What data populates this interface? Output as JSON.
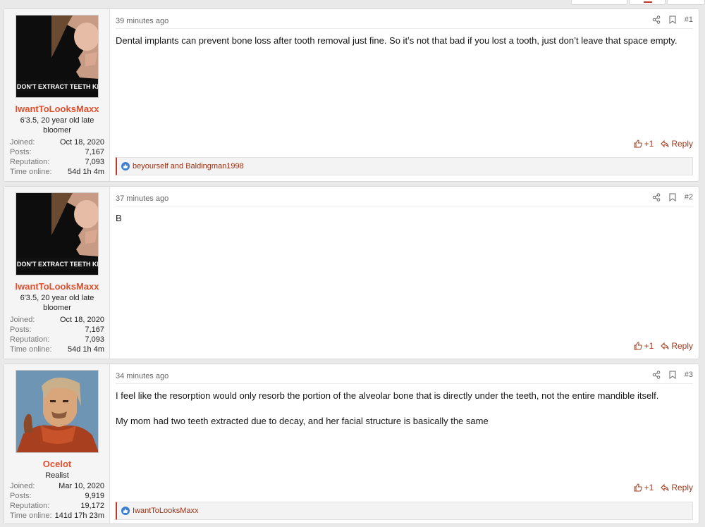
{
  "posts": [
    {
      "user": {
        "name": "IwantToLooksMaxx",
        "title": "6'3.5, 20 year old late bloomer",
        "avatar_caption": "DON'T EXTRACT TEETH KI",
        "joined": "Oct 18, 2020",
        "posts": "7,167",
        "reputation": "7,093",
        "time_online": "54d 1h 4m"
      },
      "time": "39 minutes ago",
      "number": "#1",
      "body": [
        "Dental implants can prevent bone loss after tooth removal just fine. So it’s not that bad if you lost a tooth, just don’t leave that space empty."
      ],
      "like_count": "+1",
      "reply_label": "Reply",
      "reactions": "beyourself and Baldingman1998"
    },
    {
      "user": {
        "name": "IwantToLooksMaxx",
        "title": "6'3.5, 20 year old late bloomer",
        "avatar_caption": "DON'T EXTRACT TEETH KI",
        "joined": "Oct 18, 2020",
        "posts": "7,167",
        "reputation": "7,093",
        "time_online": "54d 1h 4m"
      },
      "time": "37 minutes ago",
      "number": "#2",
      "body": [
        "B"
      ],
      "like_count": "+1",
      "reply_label": "Reply"
    },
    {
      "user": {
        "name": "Ocelot",
        "title": "Realist",
        "joined": "Mar 10, 2020",
        "posts": "9,919",
        "reputation": "19,172",
        "time_online": "141d 17h 23m"
      },
      "time": "34 minutes ago",
      "number": "#3",
      "body": [
        "I feel like the resorption would only resorb the portion of the alveolar bone that is directly under the teeth, not the entire mandible itself.",
        "My mom had two teeth extracted due to decay, and her facial structure is basically the same"
      ],
      "like_count": "+1",
      "reply_label": "Reply",
      "reactions": "IwantToLooksMaxx"
    }
  ],
  "labels": {
    "joined": "Joined:",
    "posts": "Posts:",
    "reputation": "Reputation:",
    "time_online": "Time online:"
  },
  "colors": {
    "username": "#e0502e",
    "action": "#a33a1a",
    "reaction_bar": "#c0392b"
  },
  "icons": [
    "share-icon",
    "bookmark-icon",
    "thumbs-up-icon",
    "reply-icon",
    "like-reaction-icon"
  ]
}
